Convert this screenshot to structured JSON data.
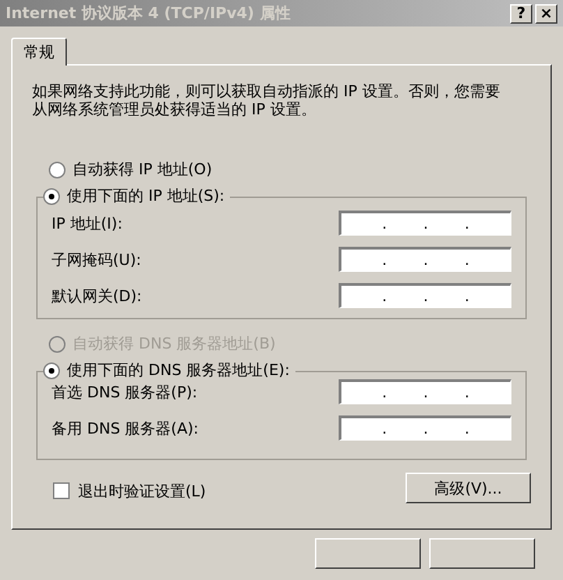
{
  "window": {
    "title": "Internet 协议版本 4 (TCP/IPv4) 属性",
    "buttons": [
      "?",
      "×"
    ]
  },
  "tabs": [
    {
      "label": "常规",
      "selected": true
    }
  ],
  "intro": "如果网络支持此功能，则可以获取自动指派的 IP 设置。否则，您需要从网络系统管理员处获得适当的 IP 设置。",
  "ip_mode": [
    {
      "label": "自动获得 IP 地址(O)",
      "selected": false,
      "disabled": false
    },
    {
      "label": "使用下面的 IP 地址(S):",
      "selected": true,
      "disabled": false
    }
  ],
  "ip_fields": [
    {
      "label": "IP 地址(I):",
      "separator": "."
    },
    {
      "label": "子网掩码(U):",
      "separator": "."
    },
    {
      "label": "默认网关(D):",
      "separator": "."
    }
  ],
  "dns_mode": [
    {
      "label": "自动获得 DNS 服务器地址(B)",
      "selected": false,
      "disabled": true
    },
    {
      "label": "使用下面的 DNS 服务器地址(E):",
      "selected": true,
      "disabled": false
    }
  ],
  "dns_fields": [
    {
      "label": "首选 DNS 服务器(P):",
      "separator": "."
    },
    {
      "label": "备用 DNS 服务器(A):",
      "separator": "."
    }
  ],
  "validate": {
    "label": "退出时验证设置(L)",
    "checked": false
  },
  "advanced_button": "高级(V)..."
}
